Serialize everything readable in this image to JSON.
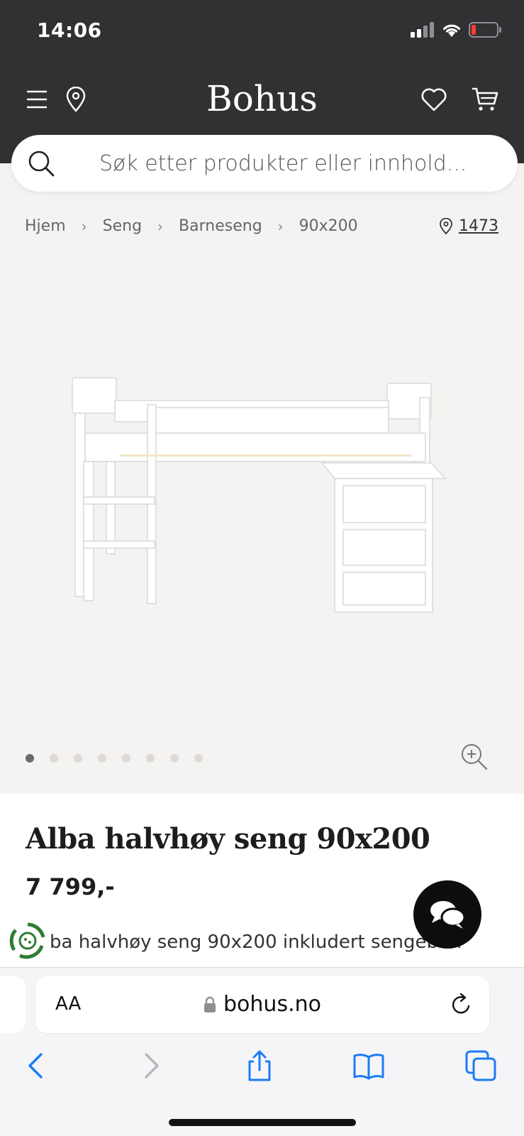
{
  "status": {
    "time": "14:06"
  },
  "header": {
    "logo": "Bohus"
  },
  "search": {
    "placeholder": "Søk etter produkter eller innhold..."
  },
  "breadcrumb": [
    "Hjem",
    "Seng",
    "Barneseng",
    "90x200"
  ],
  "store": {
    "number": "1473"
  },
  "gallery": {
    "image_count": 8,
    "active_index": 0
  },
  "product": {
    "title": "Alba halvhøy seng 90x200",
    "price": "7 799,-",
    "description": "ba halvhøy seng 90x200 inkludert sengebunn,"
  },
  "browser": {
    "aa": "AA",
    "url": "bohus.no"
  },
  "colors": {
    "header_bg": "#313134",
    "page_bg": "#f5f3f1",
    "ios_blue": "#1a7cf5",
    "eco_green": "#2e7d32"
  }
}
